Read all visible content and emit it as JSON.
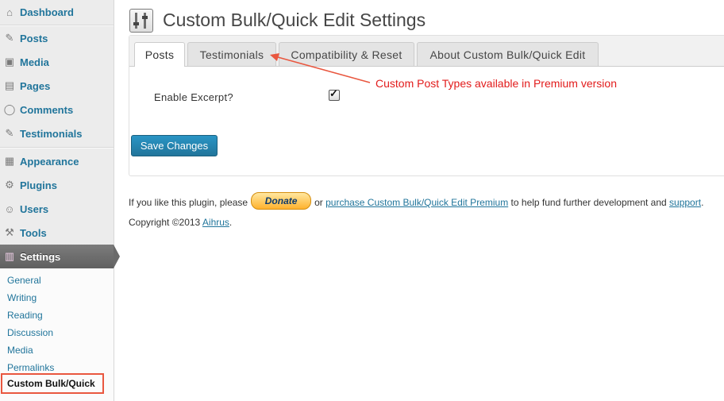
{
  "menu": [
    {
      "label": "Dashboard",
      "icon": "dashboard-icon"
    },
    {
      "label": "Posts",
      "icon": "pin-icon"
    },
    {
      "label": "Media",
      "icon": "media-icon"
    },
    {
      "label": "Pages",
      "icon": "pages-icon"
    },
    {
      "label": "Comments",
      "icon": "comment-icon"
    },
    {
      "label": "Testimonials",
      "icon": "pin-icon"
    },
    {
      "label": "Appearance",
      "icon": "appearance-icon"
    },
    {
      "label": "Plugins",
      "icon": "plugin-icon"
    },
    {
      "label": "Users",
      "icon": "users-icon"
    },
    {
      "label": "Tools",
      "icon": "tools-icon"
    },
    {
      "label": "Settings",
      "icon": "settings-icon"
    }
  ],
  "submenu": [
    "General",
    "Writing",
    "Reading",
    "Discussion",
    "Media",
    "Permalinks",
    "Custom Bulk/Quick"
  ],
  "page": {
    "title": "Custom Bulk/Quick Edit Settings"
  },
  "tabs": [
    "Posts",
    "Testimonials",
    "Compatibility & Reset",
    "About Custom Bulk/Quick Edit"
  ],
  "form": {
    "excerpt_label": "Enable Excerpt?",
    "excerpt_checked": true,
    "save_label": "Save Changes"
  },
  "annotation": {
    "text": "Custom Post Types available in Premium version",
    "color": "#e21b1b"
  },
  "footer": {
    "prefix": "If you like this plugin, please",
    "donate": "Donate",
    "or": "or",
    "premium_link": "purchase Custom Bulk/Quick Edit Premium",
    "mid": "to help fund further development and",
    "support_link": "support",
    "end": ".",
    "copyright": "Copyright ©2013",
    "author_link": "Aihrus",
    "copyright_end": "."
  },
  "colors": {
    "link": "#21759b",
    "accent_highlight": "#e9573f"
  }
}
